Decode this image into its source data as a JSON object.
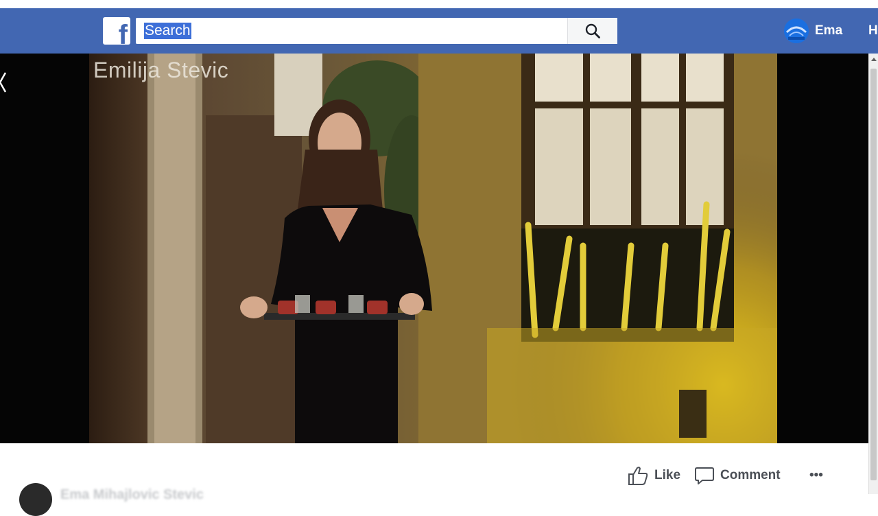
{
  "navbar": {
    "brand_color": "#4267b2",
    "logo_glyph": "f",
    "search": {
      "value": "Search",
      "placeholder": "Search",
      "icon": "search-icon"
    },
    "profile": {
      "name": "Ema",
      "avatar_icon": "profile-avatar"
    },
    "home_label": "H"
  },
  "video": {
    "watermark": "Emilija Stevic",
    "back_icon": "chevron-left-icon"
  },
  "post_actions": {
    "like_label": "Like",
    "like_icon": "thumbs-up-icon",
    "comment_label": "Comment",
    "comment_icon": "speech-bubble-icon",
    "more_label": "•••"
  },
  "comment_preview": {
    "author": "Ema Mihajlovic Stevic"
  }
}
